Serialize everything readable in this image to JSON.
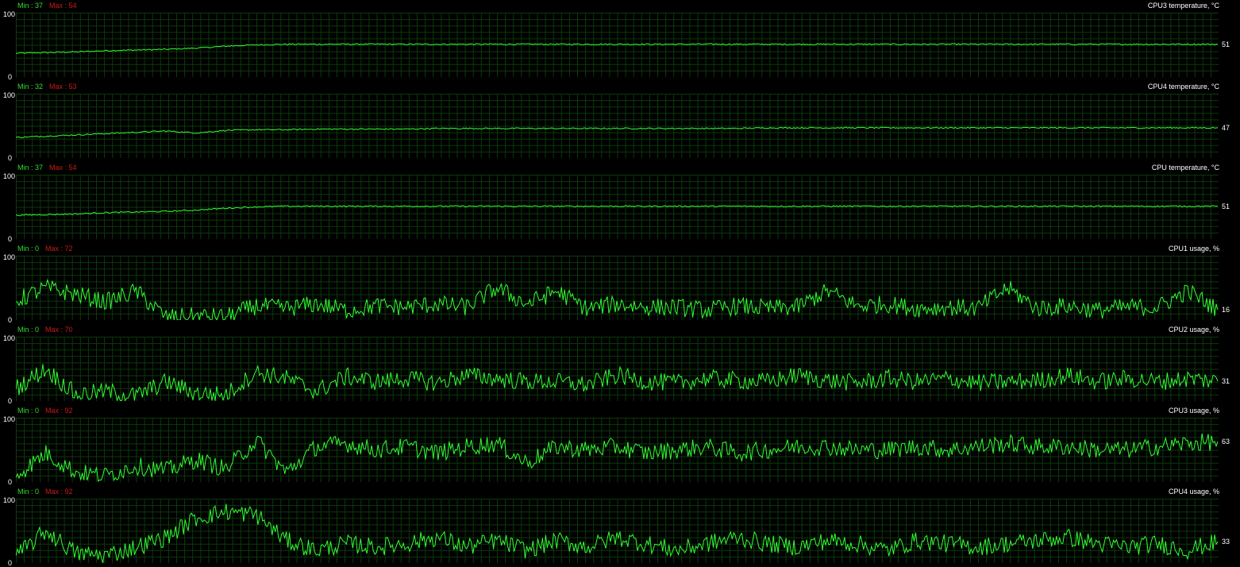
{
  "ui": {
    "min_label": "Min : ",
    "max_label": "Max : ",
    "y_axis_top": "100",
    "y_axis_bottom": "0"
  },
  "colors": {
    "background": "#000000",
    "grid": "#0b3a0b",
    "line": "#33ff33",
    "min_text": "#33dd33",
    "max_text": "#cc1a1a",
    "label_text": "#ffffff"
  },
  "panels": [
    {
      "title": "CPU3 temperature, °C",
      "min": "37",
      "max": "54",
      "current": "51"
    },
    {
      "title": "CPU4 temperature, °C",
      "min": "32",
      "max": "53",
      "current": "47"
    },
    {
      "title": "CPU temperature, °C",
      "min": "37",
      "max": "54",
      "current": "51"
    },
    {
      "title": "CPU1 usage, %",
      "min": "0",
      "max": "72",
      "current": "16"
    },
    {
      "title": "CPU2 usage, %",
      "min": "0",
      "max": "70",
      "current": "31"
    },
    {
      "title": "CPU3 usage, %",
      "min": "0",
      "max": "92",
      "current": "63"
    },
    {
      "title": "CPU4 usage, %",
      "min": "0",
      "max": "92",
      "current": "33"
    }
  ],
  "chart_data": [
    {
      "type": "line",
      "title": "CPU3 temperature, °C",
      "ylim": [
        0,
        100
      ],
      "grid": true,
      "series": [
        {
          "values": [
            37,
            38,
            39,
            41,
            42,
            43,
            45,
            48,
            50,
            51,
            51,
            51,
            51,
            51,
            51,
            51,
            51,
            51,
            51,
            51,
            51,
            51,
            51,
            51,
            51,
            51,
            51,
            51,
            51,
            51,
            51,
            51,
            51,
            51,
            51,
            51,
            51,
            51,
            51,
            51,
            51
          ]
        }
      ]
    },
    {
      "type": "line",
      "title": "CPU4 temperature, °C",
      "ylim": [
        0,
        100
      ],
      "grid": true,
      "series": [
        {
          "values": [
            32,
            34,
            36,
            38,
            40,
            42,
            39,
            43,
            44,
            44,
            45,
            45,
            45,
            45,
            46,
            46,
            46,
            46,
            46,
            46,
            46,
            46,
            46,
            46,
            46,
            47,
            47,
            47,
            47,
            47,
            47,
            47,
            47,
            47,
            47,
            47,
            47,
            47,
            47,
            47,
            47
          ]
        }
      ]
    },
    {
      "type": "line",
      "title": "CPU temperature, °C",
      "ylim": [
        0,
        100
      ],
      "grid": true,
      "series": [
        {
          "values": [
            37,
            38,
            39,
            41,
            42,
            43,
            45,
            48,
            50,
            51,
            51,
            51,
            51,
            51,
            51,
            51,
            51,
            51,
            51,
            51,
            51,
            51,
            51,
            51,
            51,
            51,
            51,
            51,
            51,
            51,
            51,
            51,
            51,
            51,
            51,
            51,
            51,
            51,
            51,
            51,
            51
          ]
        }
      ]
    },
    {
      "type": "line",
      "title": "CPU1 usage, %",
      "ylim": [
        0,
        100
      ],
      "grid": true,
      "series": [
        {
          "values": [
            30,
            50,
            40,
            28,
            45,
            4,
            6,
            5,
            22,
            18,
            25,
            15,
            22,
            20,
            25,
            20,
            50,
            25,
            45,
            18,
            25,
            20,
            20,
            15,
            22,
            18,
            20,
            45,
            22,
            25,
            18,
            20,
            18,
            50,
            18,
            22,
            15,
            20,
            20,
            45,
            16
          ]
        }
      ]
    },
    {
      "type": "line",
      "title": "CPU2 usage, %",
      "ylim": [
        0,
        100
      ],
      "grid": true,
      "series": [
        {
          "values": [
            20,
            50,
            10,
            15,
            8,
            30,
            12,
            10,
            45,
            35,
            15,
            38,
            30,
            35,
            28,
            40,
            35,
            30,
            30,
            25,
            40,
            30,
            28,
            35,
            32,
            30,
            40,
            32,
            28,
            35,
            30,
            35,
            28,
            30,
            32,
            40,
            30,
            35,
            30,
            35,
            31
          ]
        }
      ]
    },
    {
      "type": "line",
      "title": "CPU3 usage, %",
      "ylim": [
        0,
        100
      ],
      "grid": true,
      "series": [
        {
          "values": [
            10,
            45,
            15,
            10,
            25,
            18,
            35,
            20,
            65,
            15,
            55,
            60,
            50,
            55,
            45,
            55,
            60,
            30,
            55,
            50,
            55,
            45,
            50,
            55,
            45,
            50,
            55,
            55,
            50,
            50,
            55,
            50,
            55,
            60,
            55,
            55,
            50,
            50,
            55,
            60,
            63
          ]
        }
      ]
    },
    {
      "type": "line",
      "title": "CPU4 usage, %",
      "ylim": [
        0,
        100
      ],
      "grid": true,
      "series": [
        {
          "values": [
            10,
            50,
            15,
            12,
            25,
            40,
            70,
            80,
            75,
            35,
            20,
            30,
            25,
            30,
            40,
            25,
            35,
            20,
            35,
            25,
            40,
            30,
            20,
            30,
            40,
            30,
            25,
            35,
            30,
            20,
            35,
            30,
            25,
            30,
            35,
            40,
            30,
            25,
            30,
            20,
            33
          ]
        }
      ]
    }
  ]
}
